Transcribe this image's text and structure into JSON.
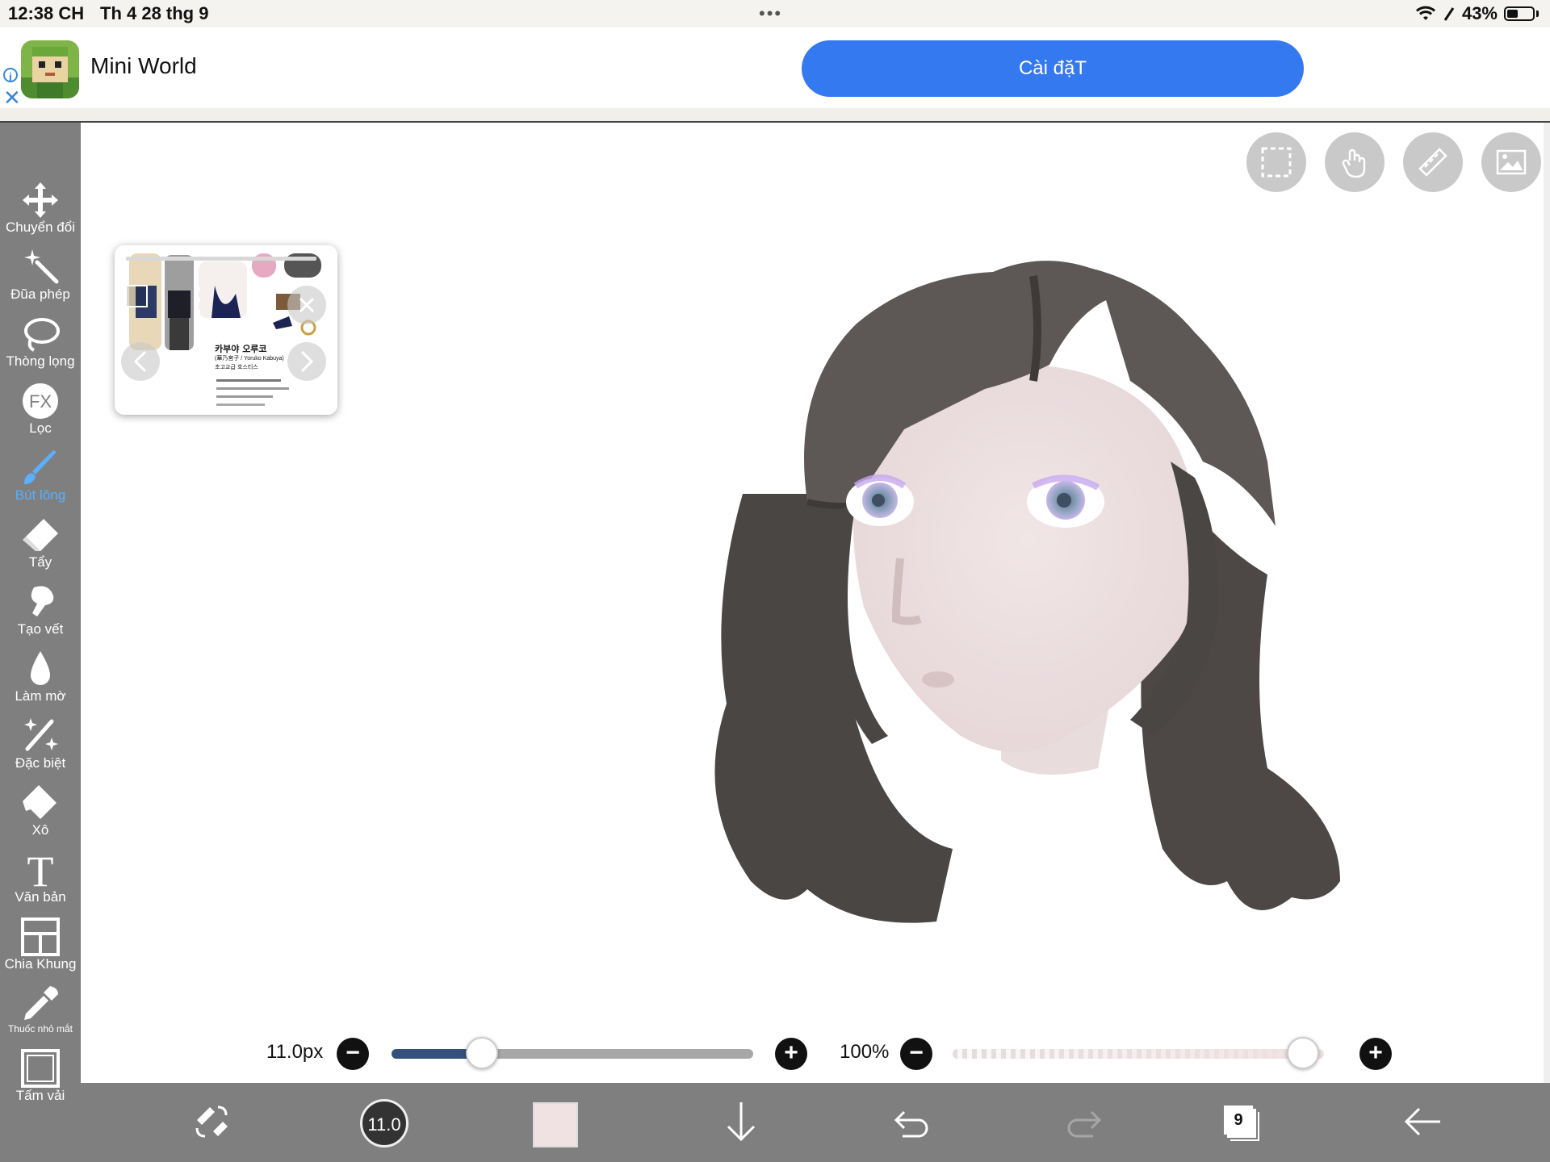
{
  "status": {
    "time": "12:38 CH",
    "date": "Th 4 28 thg 9",
    "battery": "43%"
  },
  "ad": {
    "title": "Mini World",
    "button": "Cài đặT"
  },
  "tools": [
    {
      "label": "Chuyển đổi",
      "icon": "move-icon"
    },
    {
      "label": "Đũa phép",
      "icon": "magic-wand-icon"
    },
    {
      "label": "Thòng lọng",
      "icon": "lasso-icon"
    },
    {
      "label": "Lọc",
      "icon": "fx-filter-icon",
      "glyph": "FX"
    },
    {
      "label": "Bút lông",
      "icon": "brush-icon",
      "active": true
    },
    {
      "label": "Tẩy",
      "icon": "eraser-icon"
    },
    {
      "label": "Tạo vết",
      "icon": "smudge-icon"
    },
    {
      "label": "Làm mờ",
      "icon": "blur-drop-icon"
    },
    {
      "label": "Đặc biệt",
      "icon": "special-sparkle-icon"
    },
    {
      "label": "Xô",
      "icon": "bucket-icon"
    },
    {
      "label": "Văn bản",
      "icon": "text-icon",
      "glyph": "T"
    },
    {
      "label": "Chia Khung",
      "icon": "frame-divide-icon"
    },
    {
      "label": "Thuốc nhỏ mắt",
      "icon": "eyedropper-icon"
    },
    {
      "label": "Tấm vải",
      "icon": "canvas-icon"
    }
  ],
  "reference": {
    "name": "카부야 오루코",
    "subtitle": "(華乃宮子 / Yoruko Kabuya)",
    "line3": "초고교급 호스티스"
  },
  "brush": {
    "size_label": "11.0px",
    "size_value": 11.0,
    "size_fraction": 0.25,
    "indicator": "11.0"
  },
  "opacity": {
    "label": "100%",
    "fraction": 1.0
  },
  "colors": {
    "accent": "#3479f0",
    "active_tool": "#5ab0ff",
    "current_color": "#f0e1e2",
    "toolbar": "#7f7f7f"
  },
  "layers": {
    "count": "9"
  }
}
